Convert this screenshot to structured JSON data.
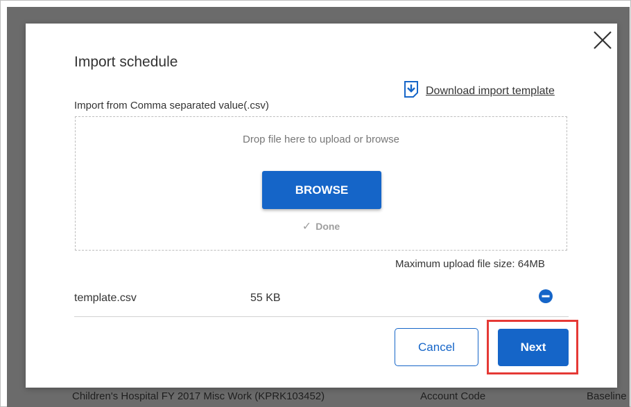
{
  "background": {
    "row_left": "Children's Hospital   FY 2017 Misc Work (KPRK103452)",
    "row_mid": "Account Code",
    "row_right": "Baseline"
  },
  "dialog": {
    "title": "Import schedule",
    "download_link": "Download import template",
    "import_label": "Import from Comma separated value(.csv)",
    "drop_text": "Drop file here to upload or browse",
    "browse_label": "BROWSE",
    "done_label": "Done",
    "max_size": "Maximum upload file size: 64MB",
    "file": {
      "name": "template.csv",
      "size": "55 KB"
    },
    "cancel_label": "Cancel",
    "next_label": "Next"
  },
  "colors": {
    "accent": "#1565c8",
    "highlight": "#e53935",
    "overlay": "#6b6b6b"
  },
  "icons": {
    "close": "close-icon",
    "download": "download-file-icon",
    "check": "check-icon",
    "remove": "remove-circle-icon"
  }
}
